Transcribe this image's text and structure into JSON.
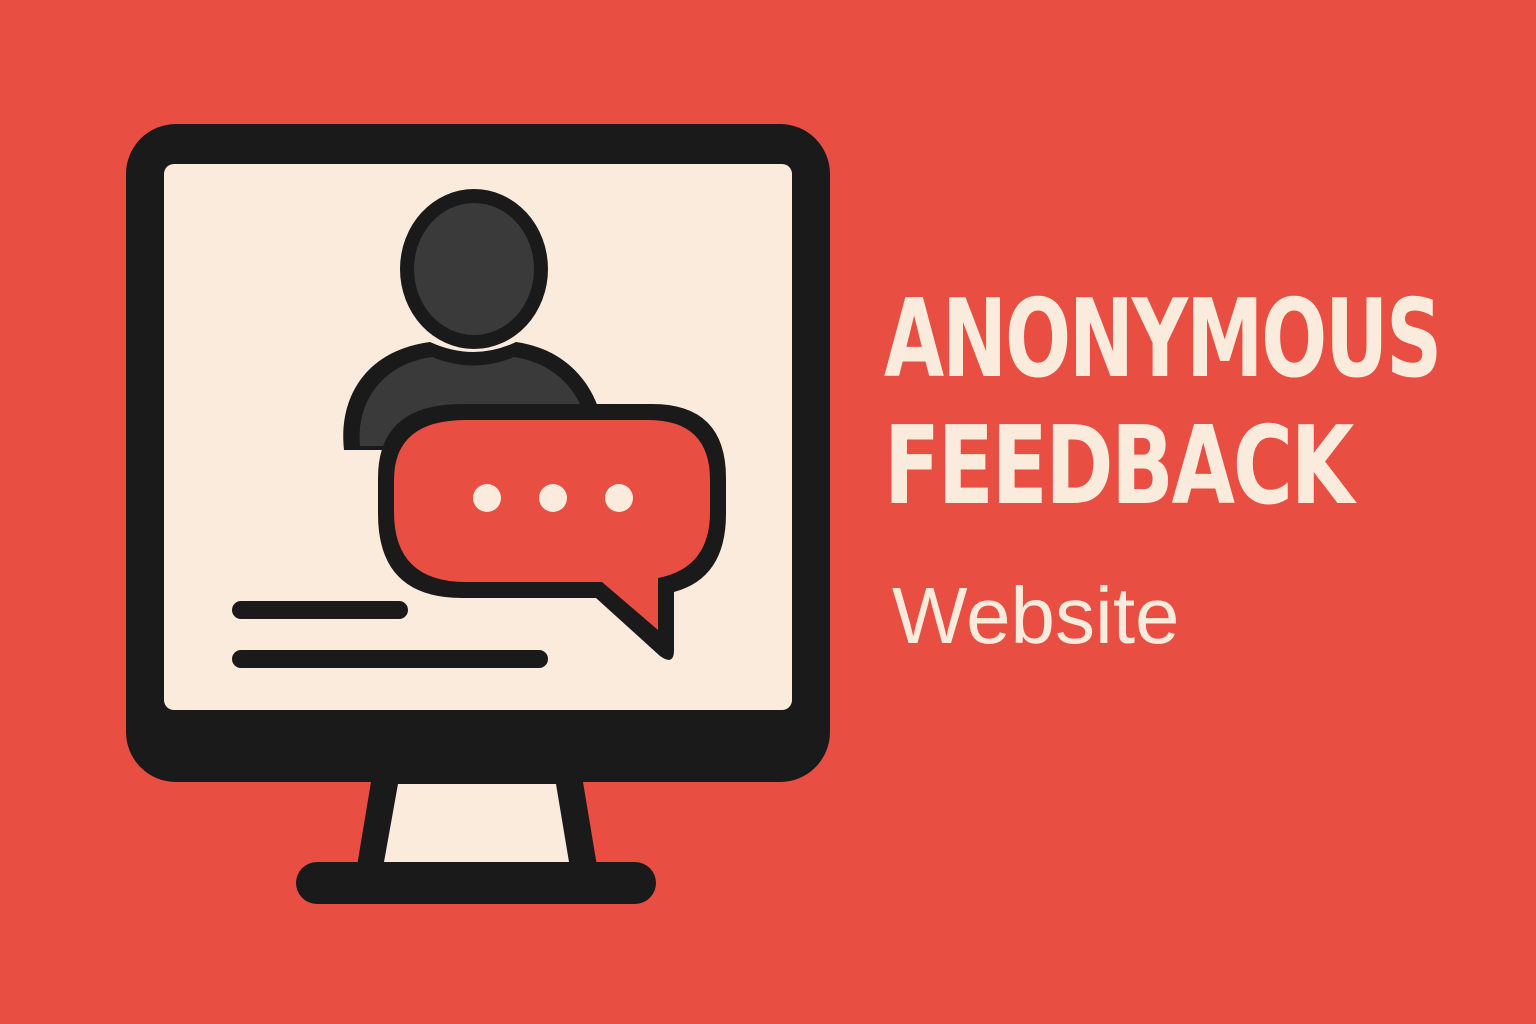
{
  "colors": {
    "background": "#E94E42",
    "outline": "#1B1A1A",
    "screen": "#FBEBDD",
    "person": "#3A3A3A",
    "bubble": "#E94E42",
    "text": "#FBEBDD"
  },
  "title": {
    "line1": "ANONYMOUS",
    "line2": "FEEDBACK",
    "subtitle": "Website"
  },
  "icons": {
    "monitor": "monitor-icon",
    "person": "user-silhouette-icon",
    "bubble": "chat-bubble-icon",
    "dots": "ellipsis-icon"
  }
}
